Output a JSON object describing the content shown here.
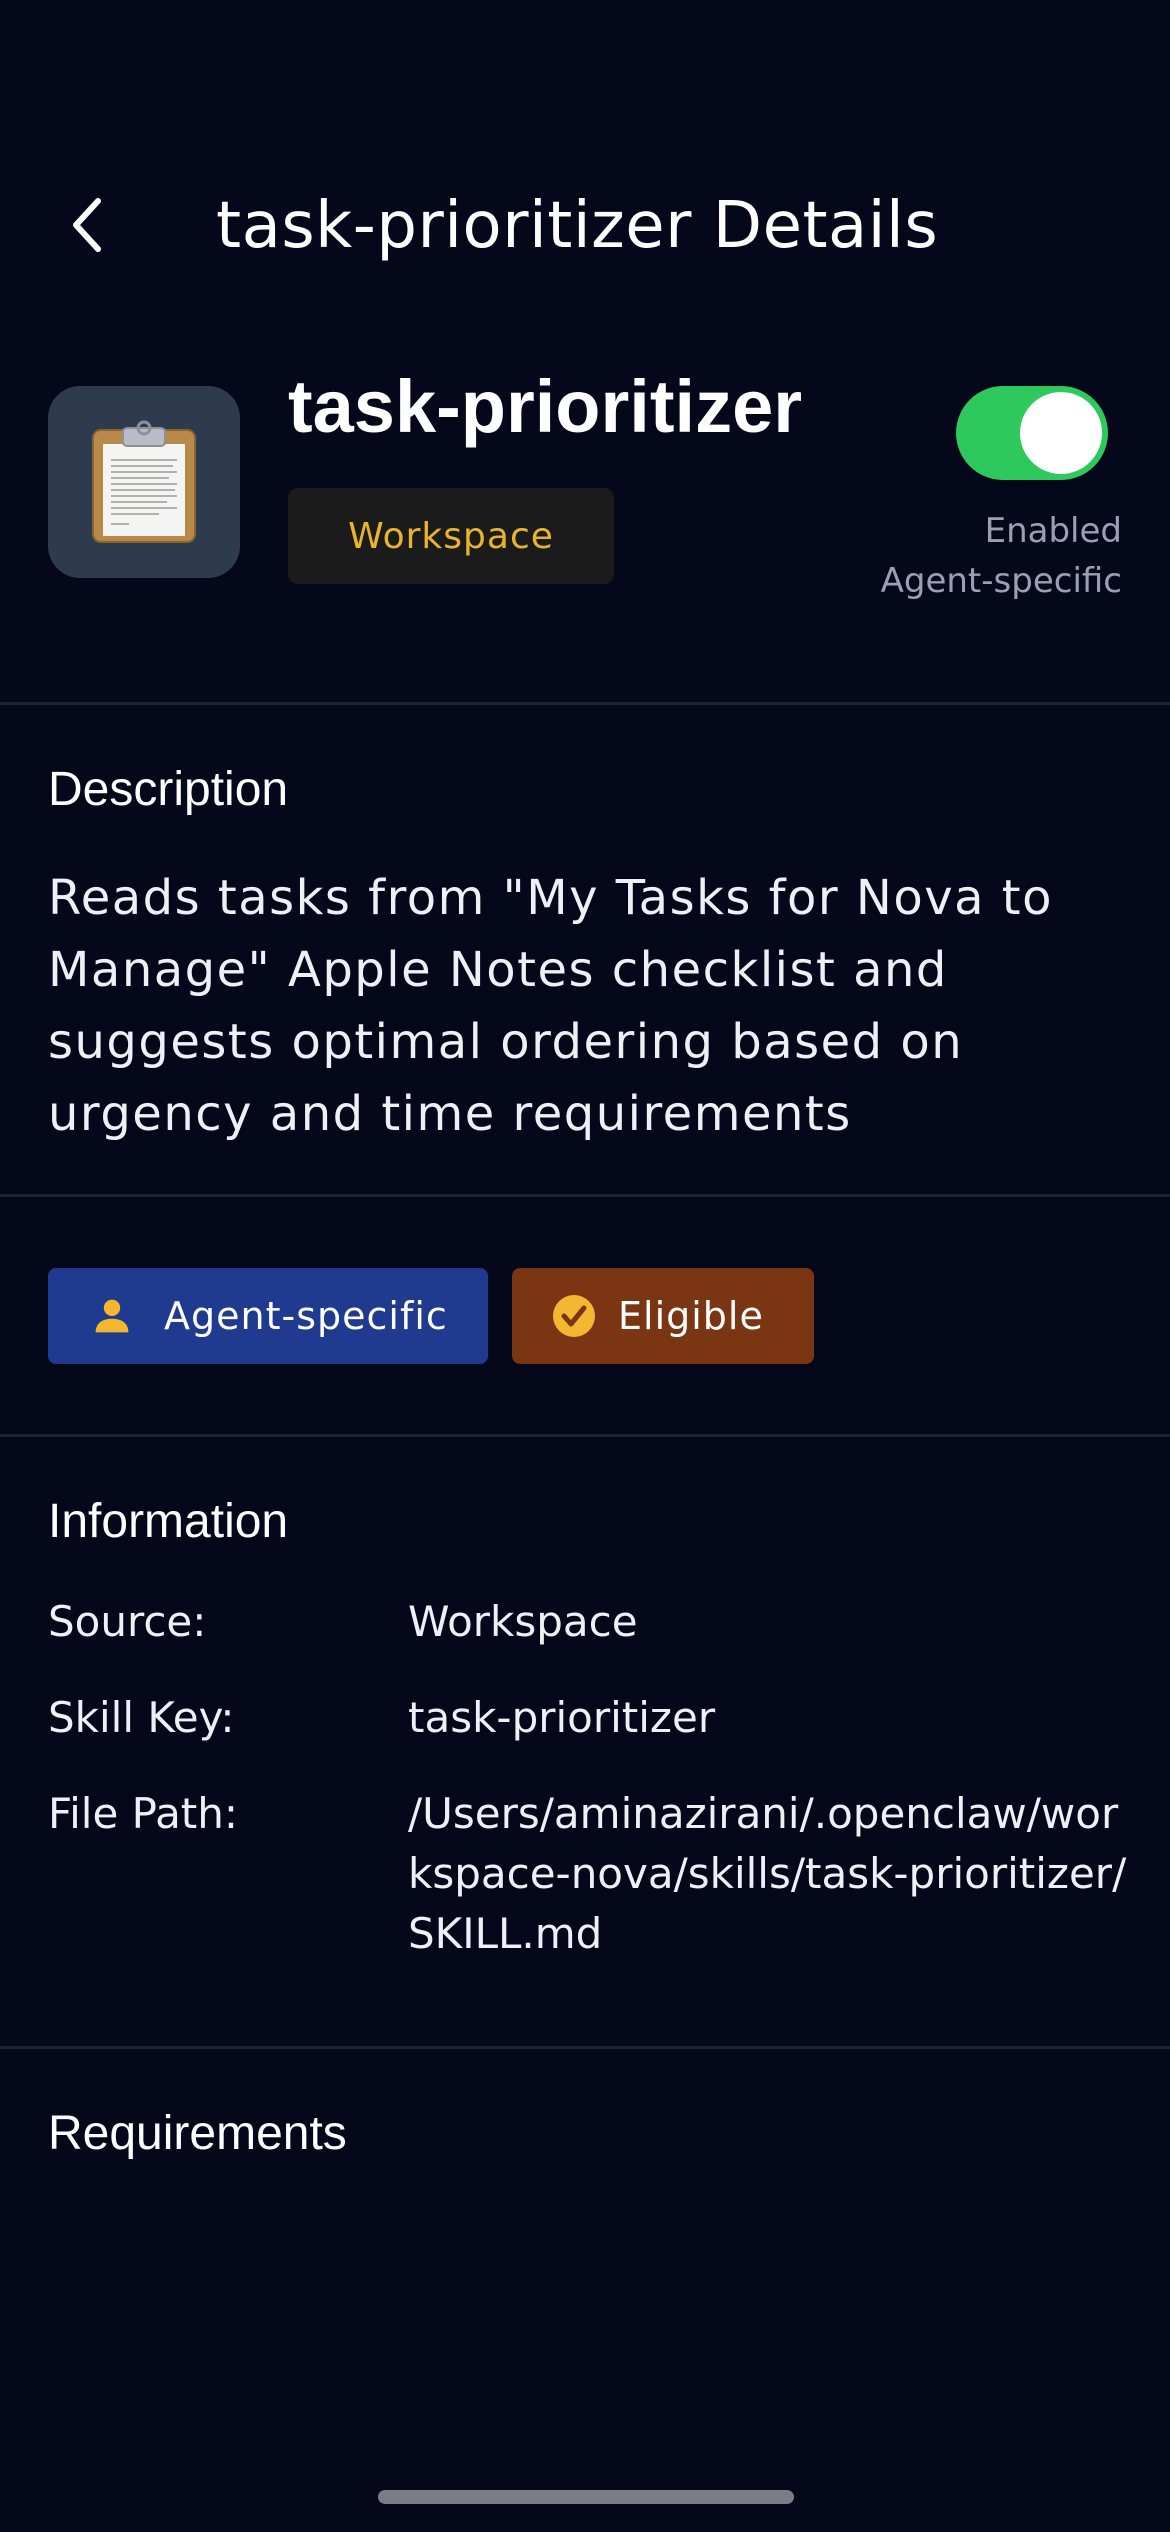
{
  "header": {
    "title": "task-prioritizer Details"
  },
  "skill": {
    "icon": "clipboard-icon",
    "name": "task-prioritizer",
    "source_badge": "Workspace",
    "toggle_enabled": true,
    "status_label": "Enabled",
    "status_sub": "Agent-specific"
  },
  "description": {
    "title": "Description",
    "text": "Reads tasks from \"My Tasks for Nova to Manage\" Apple Notes checklist and suggests optimal ordering based on urgency and time requirements"
  },
  "tags": [
    {
      "label": "Agent-specific",
      "icon": "person-icon"
    },
    {
      "label": "Eligible",
      "icon": "check-circle-icon"
    }
  ],
  "information": {
    "title": "Information",
    "rows": [
      {
        "label": "Source:",
        "value": "Workspace"
      },
      {
        "label": "Skill Key:",
        "value": "task-prioritizer"
      },
      {
        "label": "File Path:",
        "value": "/Users/aminazirani/.openclaw/workspace-nova/skills/task-prioritizer/SKILL.md"
      }
    ]
  },
  "requirements": {
    "title": "Requirements"
  },
  "colors": {
    "background": "#05071a",
    "toggle_on": "#2ec95c",
    "workspace_text": "#e8b52a",
    "agent_tag": "#1f3a8e",
    "eligible_tag": "#7a3513"
  }
}
